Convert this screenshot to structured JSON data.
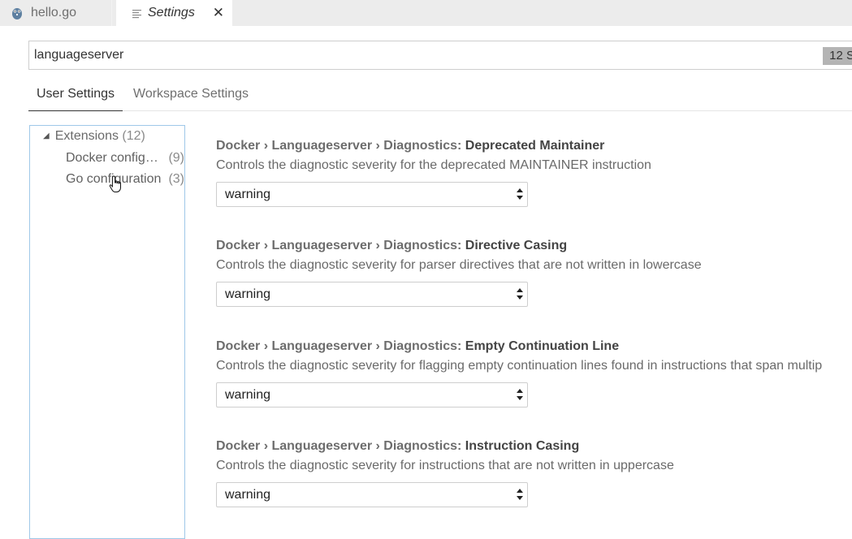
{
  "tabs": {
    "hello": {
      "label": "hello.go",
      "icon": "gopher-icon"
    },
    "settings": {
      "label": "Settings",
      "icon": "document-icon",
      "close": "✕"
    }
  },
  "search": {
    "value": "languageserver",
    "result_count": "12 S"
  },
  "settings_tabs": {
    "user": "User Settings",
    "workspace": "Workspace Settings"
  },
  "toc": {
    "extensions": {
      "label": "Extensions",
      "count": "(12)"
    },
    "items": [
      {
        "label": "Docker configuration",
        "count": "(9)"
      },
      {
        "label": "Go configuration",
        "count": "(3)"
      }
    ]
  },
  "settings": [
    {
      "path": "Docker › Languageserver › Diagnostics: ",
      "name": "Deprecated Maintainer",
      "description": "Controls the diagnostic severity for the deprecated MAINTAINER instruction",
      "value": "warning"
    },
    {
      "path": "Docker › Languageserver › Diagnostics: ",
      "name": "Directive Casing",
      "description": "Controls the diagnostic severity for parser directives that are not written in lowercase",
      "value": "warning"
    },
    {
      "path": "Docker › Languageserver › Diagnostics: ",
      "name": "Empty Continuation Line",
      "description": "Controls the diagnostic severity for flagging empty continuation lines found in instructions that span multip",
      "value": "warning"
    },
    {
      "path": "Docker › Languageserver › Diagnostics: ",
      "name": "Instruction Casing",
      "description": "Controls the diagnostic severity for instructions that are not written in uppercase",
      "value": "warning"
    }
  ],
  "colors": {
    "toc_border": "#9fc8e8",
    "tab_bar": "#ececec",
    "badge": "#b4b4b4"
  }
}
